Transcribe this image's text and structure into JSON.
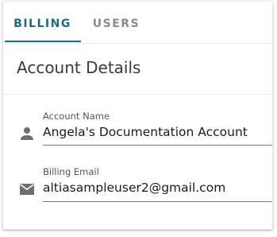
{
  "tabs": [
    {
      "label": "BILLING",
      "active": true
    },
    {
      "label": "USERS",
      "active": false
    }
  ],
  "section": {
    "title": "Account Details"
  },
  "fields": {
    "account_name": {
      "label": "Account Name",
      "value": "Angela's Documentation Account",
      "icon": "person-icon"
    },
    "billing_email": {
      "label": "Billing Email",
      "value": "altiasampleuser2@gmail.com",
      "icon": "email-icon"
    }
  },
  "colors": {
    "accent": "#1d6a85",
    "inactive_tab": "#8a8a8a",
    "icon": "#6e6e6e"
  }
}
